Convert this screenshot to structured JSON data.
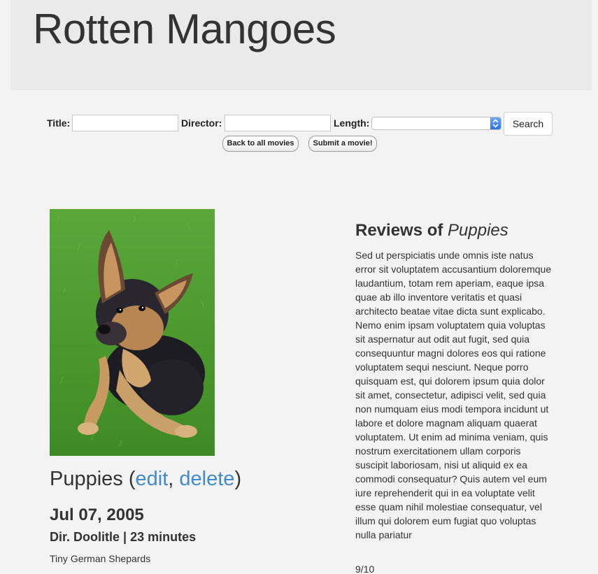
{
  "header": {
    "site_title": "Rotten Mangoes"
  },
  "search": {
    "title_label": "Title:",
    "title_value": "",
    "director_label": "Director:",
    "director_value": "",
    "length_label": "Length:",
    "length_selected": "",
    "search_button": "Search"
  },
  "nav": {
    "back_link": "Back to all movies",
    "submit_link": "Submit a movie!"
  },
  "movie": {
    "title": "Puppies",
    "edit_link": "edit",
    "delete_link": "delete",
    "release_date": "Jul 07, 2005",
    "director_prefix": "Dir. ",
    "director": "Doolitle",
    "separator": " | ",
    "runtime": "23 minutes",
    "description": "Tiny German Shepards",
    "poster_icon": "puppy-photo"
  },
  "reviews": {
    "heading_prefix": "Reviews of ",
    "movie_title": "Puppies",
    "review_text": "Sed ut perspiciatis unde omnis iste natus error sit voluptatem accusantium doloremque laudantium, totam rem aperiam, eaque ipsa quae ab illo inventore veritatis et quasi architecto beatae vitae dicta sunt explicabo. Nemo enim ipsam voluptatem quia voluptas sit aspernatur aut odit aut fugit, sed quia consequuntur magni dolores eos qui ratione voluptatem sequi nesciunt. Neque porro quisquam est, qui dolorem ipsum quia dolor sit amet, consectetur, adipisci velit, sed quia non numquam eius modi tempora incidunt ut labore et dolore magnam aliquam quaerat voluptatem. Ut enim ad minima veniam, quis nostrum exercitationem ullam corporis suscipit laboriosam, nisi ut aliquid ex ea commodi consequatur? Quis autem vel eum iure reprehenderit qui in ea voluptate velit esse quam nihil molestiae consequatur, vel illum qui dolorem eum fugiat quo voluptas nulla pariatur",
    "rating": "9/10"
  },
  "colors": {
    "link": "#428bca",
    "background": "#f3f3f3",
    "header_background": "#eaeaea"
  }
}
